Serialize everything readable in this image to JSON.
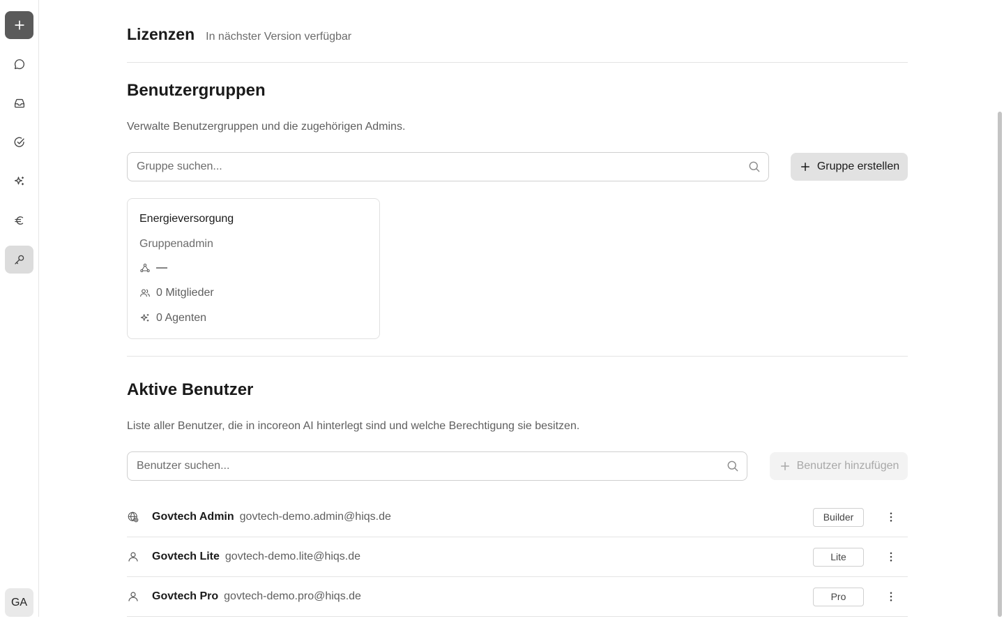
{
  "sidebar": {
    "items": [
      {
        "name": "plus-icon"
      },
      {
        "name": "chat-icon"
      },
      {
        "name": "inbox-icon"
      },
      {
        "name": "check-circle-icon"
      },
      {
        "name": "sparkles-icon"
      },
      {
        "name": "euro-icon"
      },
      {
        "name": "key-icon",
        "active": true
      }
    ],
    "avatar_initials": "GA"
  },
  "licenses": {
    "title": "Lizenzen",
    "subtitle": "In nächster Version verfügbar"
  },
  "groups": {
    "title": "Benutzergruppen",
    "description": "Verwalte Benutzergruppen und die zugehörigen Admins.",
    "search_placeholder": "Gruppe suchen...",
    "create_label": "Gruppe erstellen",
    "cards": [
      {
        "name": "Energieversorgung",
        "role_label": "Gruppenadmin",
        "admin_value": "—",
        "members": "0 Mitglieder",
        "agents": "0 Agenten"
      }
    ]
  },
  "users": {
    "title": "Aktive Benutzer",
    "description": "Liste aller Benutzer, die in incoreon AI hinterlegt sind und welche Berechtigung sie besitzen.",
    "search_placeholder": "Benutzer suchen...",
    "add_label": "Benutzer hinzufügen",
    "rows": [
      {
        "name": "Govtech Admin",
        "email": "govtech-demo.admin@hiqs.de",
        "role": "Builder",
        "icon": "admin-globe-icon"
      },
      {
        "name": "Govtech Lite",
        "email": "govtech-demo.lite@hiqs.de",
        "role": "Lite",
        "icon": "user-icon"
      },
      {
        "name": "Govtech Pro",
        "email": "govtech-demo.pro@hiqs.de",
        "role": "Pro",
        "icon": "user-icon"
      }
    ]
  },
  "colors": {
    "accent_button": "#e2e2e2",
    "new_button": "#5a5a5a",
    "text_primary": "#1a1a1a",
    "text_secondary": "#6b6b6b"
  }
}
